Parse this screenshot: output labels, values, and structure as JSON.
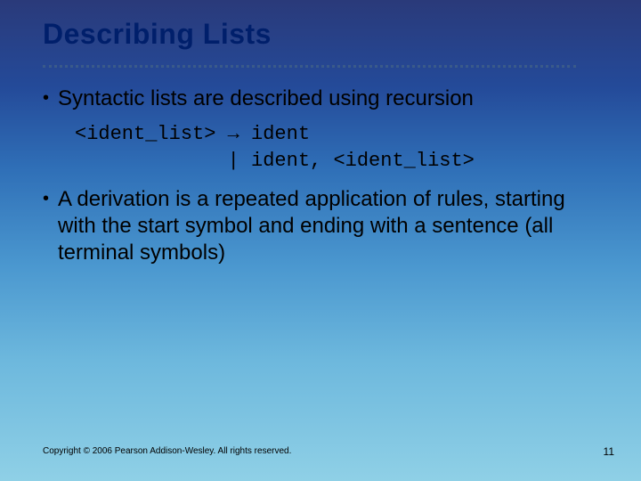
{
  "title": "Describing Lists",
  "bullets": [
    "Syntactic lists are described using recursion",
    "A derivation is a repeated application of rules, starting with the start symbol and ending with a sentence (all terminal symbols)"
  ],
  "code": {
    "line1": "<ident_list> → ident",
    "line2": "             | ident, <ident_list>"
  },
  "footer": "Copyright © 2006 Pearson Addison-Wesley. All rights reserved.",
  "page": "11"
}
